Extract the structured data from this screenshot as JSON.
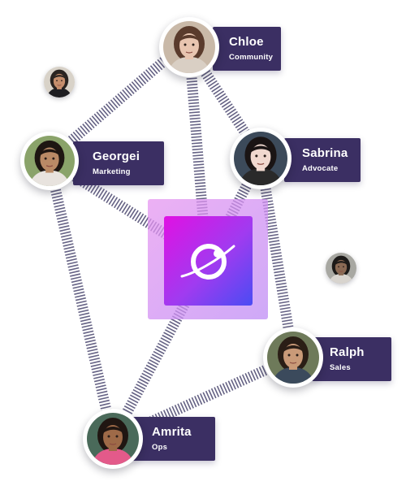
{
  "hub": {
    "icon": "planet-icon"
  },
  "people": [
    {
      "id": "chloe",
      "name": "Chloe",
      "role": "Community",
      "hair": "#5a3b2c",
      "skin": "#e8c5b0",
      "bg": "#c9b9a8",
      "shirt": "#d9cfc4"
    },
    {
      "id": "georgei",
      "name": "Georgei",
      "role": "Marketing",
      "hair": "#1e1612",
      "skin": "#b98a66",
      "bg": "#8aa36a",
      "shirt": "#e8e3de"
    },
    {
      "id": "sabrina",
      "name": "Sabrina",
      "role": "Advocate",
      "hair": "#1a1414",
      "skin": "#f0d8cf",
      "bg": "#3c4a5a",
      "shirt": "#2a2a2a"
    },
    {
      "id": "ralph",
      "name": "Ralph",
      "role": "Sales",
      "hair": "#2a1e16",
      "skin": "#c99a78",
      "bg": "#6e7a5a",
      "shirt": "#3b4a5c"
    },
    {
      "id": "amrita",
      "name": "Amrita",
      "role": "Ops",
      "hair": "#201612",
      "skin": "#9e6a48",
      "bg": "#4a6a5a",
      "shirt": "#e35a8a"
    }
  ],
  "extras": [
    {
      "id": "extra-man-1",
      "hair": "#2a2420",
      "skin": "#c58e6c",
      "bg": "#d8d2c8",
      "shirt": "#1e1e22"
    },
    {
      "id": "extra-man-2",
      "hair": "#1c1a18",
      "skin": "#8a6a54",
      "bg": "#a8a8a2",
      "shirt": "#d8d4ce"
    }
  ],
  "colors": {
    "card": "#3b2f63",
    "link": "#4a466e"
  }
}
